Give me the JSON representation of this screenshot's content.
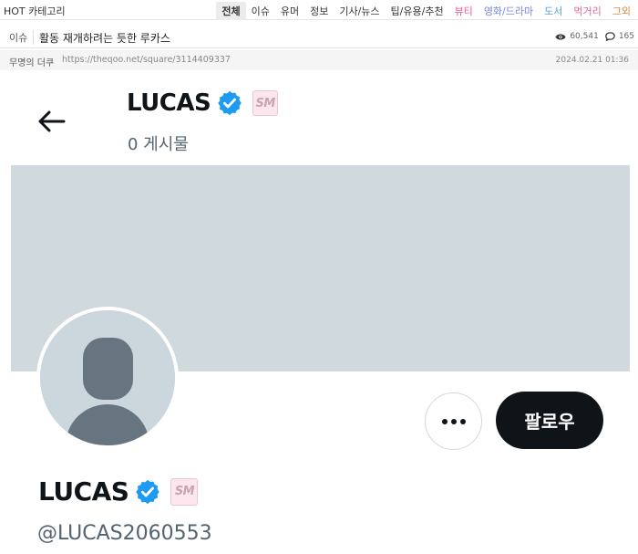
{
  "topbar": {
    "hot_label": "HOT 카테고리",
    "categories": [
      {
        "label": "전체",
        "color": "#333333",
        "active": true
      },
      {
        "label": "이슈",
        "color": "#333333"
      },
      {
        "label": "유머",
        "color": "#333333"
      },
      {
        "label": "정보",
        "color": "#333333"
      },
      {
        "label": "기사/뉴스",
        "color": "#333333"
      },
      {
        "label": "팁/유용/추천",
        "color": "#333333"
      },
      {
        "label": "뷰티",
        "color": "#e65a9e"
      },
      {
        "label": "영화/드라마",
        "color": "#7a86d8"
      },
      {
        "label": "도서",
        "color": "#5aa0d8"
      },
      {
        "label": "먹거리",
        "color": "#d86a9a"
      },
      {
        "label": "그외",
        "color": "#e08a3a"
      }
    ]
  },
  "post": {
    "category": "이슈",
    "title": "활동 재개하려는 듯한 루카스",
    "views": "60,541",
    "comments": "165",
    "author": "무명의 더쿠",
    "url": "https://theqoo.net/square/3114409337",
    "date": "2024.02.21 01:36"
  },
  "profile": {
    "header_name": "LUCAS",
    "post_count": "0 게시물",
    "name": "LUCAS",
    "handle": "@LUCAS2060553",
    "follow_label": "팔로우",
    "badge_text": "SM",
    "verified_color": "#1d9bf0",
    "banner_color": "#cfd9de"
  }
}
